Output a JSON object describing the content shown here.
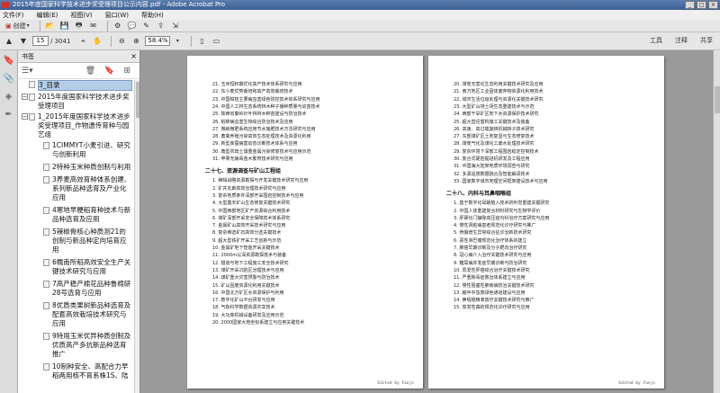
{
  "window": {
    "title": "2015年度国家科学技术进步奖受理项目公示内容.pdf - Adobe Acrobat Pro",
    "controls": [
      "_",
      "□",
      "×"
    ]
  },
  "menu": [
    "文件(F)",
    "编辑(E)",
    "视图(V)",
    "窗口(W)",
    "帮助(H)"
  ],
  "toolbar": {
    "create_label": "创建",
    "page_current": "15",
    "page_total": "/ 3041",
    "zoom": "58.4%",
    "tools_label": "工具",
    "comment_label": "注释",
    "share_label": "共享"
  },
  "bookmarks": {
    "title": "书签",
    "close": "×",
    "items": [
      {
        "label": "3_目录",
        "level": 0,
        "selected": true
      },
      {
        "label": "2015年度国家科学技术进步奖受理项目",
        "level": 0,
        "toggle": "−"
      },
      {
        "label": "1_2015年度国家科学技术进步奖受理项目_作物遗传育种与园艺组",
        "level": 1,
        "toggle": "−"
      },
      {
        "label": "1CIMMYT小麦引进、研究与创新利用",
        "level": 2
      },
      {
        "label": "2特种玉米种质创制与利用",
        "level": 2
      },
      {
        "label": "3养麦高效育种体系创建、系列新品种选育及产业化应用",
        "level": 2
      },
      {
        "label": "4寒地早粳稻育种技术与新品种选育及应用",
        "level": 2
      },
      {
        "label": "5辣椒骨核心种质测21的创制与新品种定向培育应用",
        "level": 2
      },
      {
        "label": "6糯南所稻高效安全生产关键技术研究与应用",
        "level": 2
      },
      {
        "label": "7高产稳产棉花品种鲁棉研28号选育与应用",
        "level": 2
      },
      {
        "label": "8优质类果树新品种选育及配套高效栽培技术研究与应用",
        "level": 2
      },
      {
        "label": "9特用玉米优异种质创制及优质高产多抗新品种选育推广",
        "level": 2
      },
      {
        "label": "10制种安全、高配合力早稻两用核不育系株1S、陆",
        "level": 2
      }
    ]
  },
  "page_left": {
    "lines_top": [
      "21. 玉米短籽期优化高产技术体系研究与应用",
      "22. 东小麦优势栽培和高产高效栽培技术",
      "23. 中国柑桔主要病虫害绿色防控技术体系研究与应用",
      "24. 中国人工林生态系统林木种子播种质量与幼苗技术",
      "25. 陕西省秦岭针叶林林木种苗建设与防治技术",
      "26. 稻棉病虫害生物综合防治技术及应用",
      "27. 微纳微肥系统应用节水施肥技术方法研究与应用",
      "28. 畜禽养殖污染高效生态处理技术及资源化利用",
      "29. 新型家蚕病害动态诊断技术体系与应用",
      "30. 典型农田土壤重金属污染修复技术与应用示范",
      "31. 苹果无病毒苗木繁育技术研究与应用"
    ],
    "section": "二十七、资源调查与矿山工程组",
    "lines_bottom": [
      "1. 稀缺战略资源勘探与开发关键技术研究与应用",
      "2. 矿井瓦斯高效治理技术研究与应用",
      "3. 复杂地质条件深部开采围岩控制技术与应用",
      "4. 大型露天矿山生态修复关键技术研究",
      "5. 中国西部地区矿产资源综合利用技术",
      "6. 煤矿深部开采安全保障技术体系研究",
      "7. 金属矿山高效开采技术研究与应用",
      "8. 复杂难选矿石高效分选关键技术",
      "9. 超大型铁矿开采工艺创新与示范",
      "10. 金属矿地下智能开采关键技术",
      "11. 2000m以深资源勘探技术与装备",
      "12. 隧道与地下工程施工安全技术研究",
      "13. 煤矿开采沉陷区治理技术与应用",
      "14. 煤矿重大灾害预警与防治技术",
      "15. 矿山固废资源化利用关键技术",
      "16. 中国北方矿区水资源保护与利用",
      "17. 数字化矿山平台研发与应用",
      "18. 气象科学数据资源共享技术",
      "19. 大功率机械设备研发及应用示范",
      "20. 2000国家大地坐标系建立与应用关键技术"
    ],
    "footer": "Edited by Fanjs"
  },
  "page_right": {
    "lines_top": [
      "20. 煤炭无害化生态利用关键技术研究及应用",
      "21. 南方地区工业固体废弃物资源化利用技术",
      "22. 城市生活垃圾处理与资源化关键技术研究",
      "23. 大型矿山排土场生态重建技术与示范",
      "24. 西部干旱矿区地下水资源保护技术研究",
      "25. 超大直径盾构施工关键技术及装备",
      "26. 高速、高过载旋转机械转子技术研究",
      "27. 东部煤矿区土地复垦与生态修复技术",
      "28. 煤炭气化及煤化工废水处理技术研究",
      "29. 复杂环境下深部工程围岩稳定控制技术",
      "30. 复合式硬岩掘进机研发及工程应用",
      "31. 中国海大陆架地质环境调查与研究",
      "32. 多源遥感数据融合及智能解译技术",
      "33. 国家数字城市地理空间框架建设技术与应用"
    ],
    "section": "二十八、内科与耳鼻咽喉组",
    "lines_bottom": [
      "1. 基于数字化耳蜗植入技术的听觉重建关键研究",
      "2. 中国人体重建复合材料研究与生物学评价",
      "3. 肝硬化门静脉高压症内科治疗方案研究与应用",
      "4. 慢性肾脏病患者规范化诊疗研究与推广",
      "5. 骨髓增生异常综合征诊治新技术研究",
      "6. 恶性淋巴瘤规范化治疗体系的建立",
      "7. 肺癌早期诊断及分子靶向治疗研究",
      "8. 冠心病介入治疗关键技术研究与应用",
      "9. 糖尿病并发症早期诊断与防治研究",
      "10. 原发性肝癌综合治疗关键技术研究",
      "11. 严重脓毒症救治体系建立与应用",
      "12. 慢性阻塞性肺疾病防治关键技术研究",
      "13. 脑卒中急救绿色通道建设与应用",
      "14. 鼻咽癌精准放疗关键技术研究与推广",
      "15. 突发性聋的规范化诊疗研究与应用"
    ],
    "footer": "Edited by Fanjs"
  }
}
